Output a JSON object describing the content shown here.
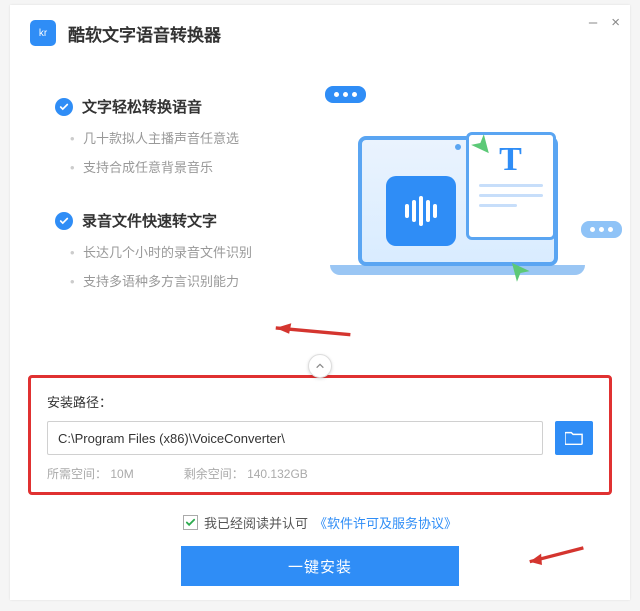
{
  "app": {
    "title": "酷软文字语音转换器",
    "icon_label": "kr"
  },
  "features": {
    "section1": {
      "title": "文字轻松转换语音",
      "items": [
        "几十款拟人主播声音任意选",
        "支持合成任意背景音乐"
      ]
    },
    "section2": {
      "title": "录音文件快速转文字",
      "items": [
        "长达几个小时的录音文件识别",
        "支持多语种多方言识别能力"
      ]
    }
  },
  "install_panel": {
    "label": "安装路径：",
    "path": "C:\\Program Files (x86)\\VoiceConverter\\",
    "required_label": "所需空间：",
    "required_value": "10M",
    "free_label": "剩余空间：",
    "free_value": "140.132GB"
  },
  "bottom": {
    "agree_text": "我已经阅读并认可",
    "agreement_link": "《软件许可及服务协议》",
    "install_button": "一键安装"
  },
  "icons": {
    "check": "check-icon",
    "folder": "folder-icon",
    "chevron_up": "chevron-up-icon",
    "minimize": "–",
    "close": "×"
  },
  "colors": {
    "primary": "#2f8df6",
    "highlight_border": "#e03131",
    "arrow": "#d4352f"
  }
}
